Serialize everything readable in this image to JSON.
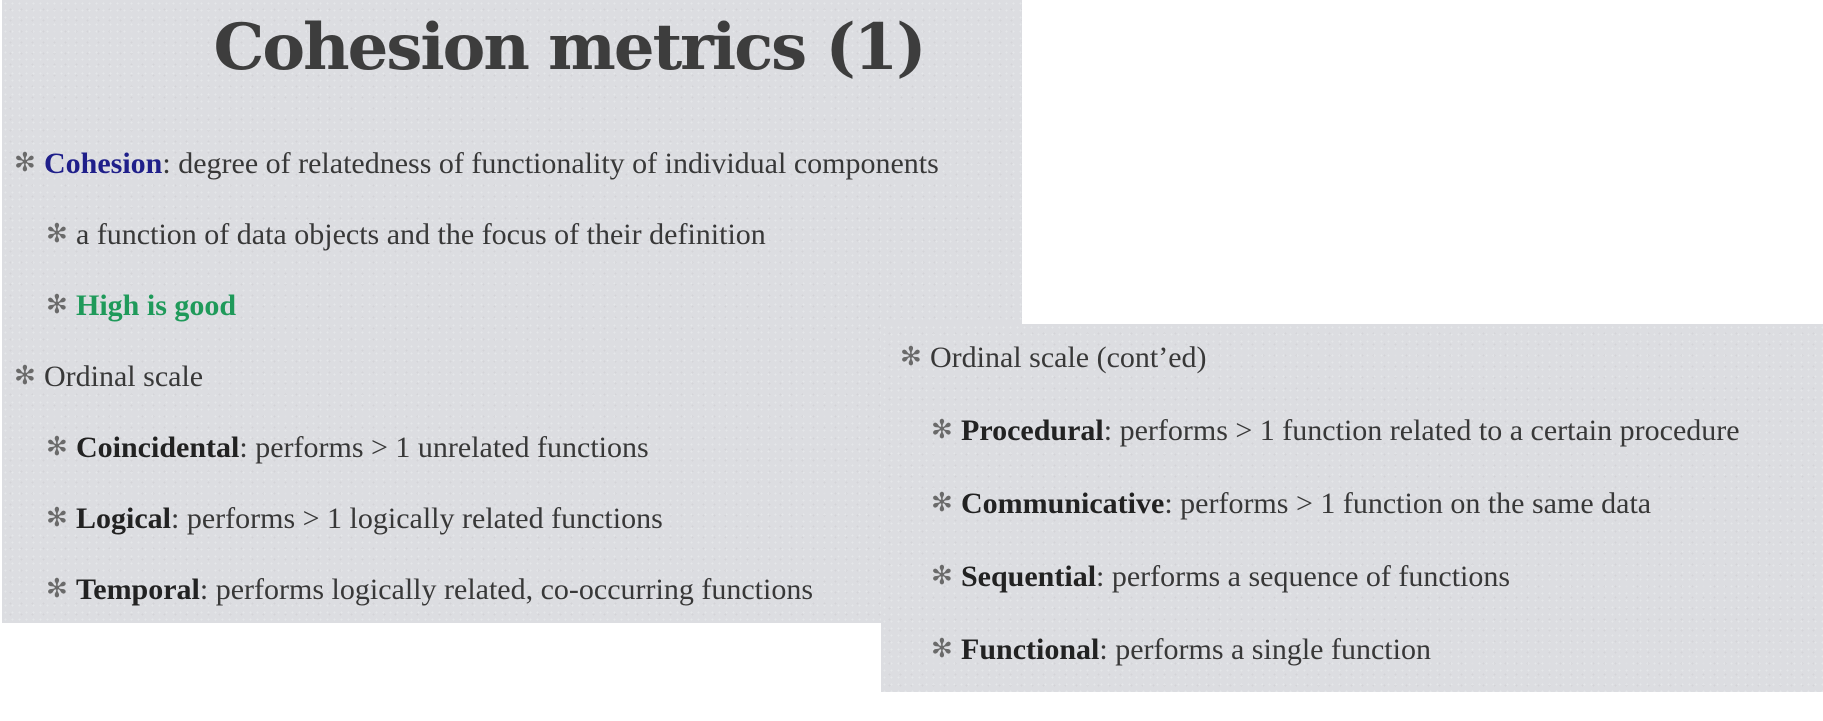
{
  "slide1": {
    "title": "Cohesion metrics (1)",
    "bullet_glyph": "✻",
    "items": [
      {
        "term": "Cohesion",
        "text": ": degree of relatedness of functionality of individual components"
      },
      {
        "text": "a function of data objects and the focus of their definition"
      },
      {
        "term": "High is good"
      },
      {
        "text": "Ordinal scale"
      },
      {
        "term": "Coincidental",
        "text": ": performs > 1 unrelated functions"
      },
      {
        "term": "Logical",
        "text": ": performs > 1 logically related functions"
      },
      {
        "term": "Temporal",
        "text": ": performs logically related, co-occurring functions"
      }
    ]
  },
  "slide2": {
    "items": [
      {
        "text": "Ordinal scale (cont’ed)"
      },
      {
        "term": "Procedural",
        "text": ": performs > 1 function related to a certain procedure"
      },
      {
        "term": "Communicative",
        "text": ": performs > 1 function on the same data"
      },
      {
        "term": "Sequential",
        "text": ": performs a sequence of functions"
      },
      {
        "term": "Functional",
        "text": ": performs a single function"
      }
    ]
  },
  "colors": {
    "slide_background": "#dcdde1",
    "body_text": "#383838",
    "cohesion_term": "#1f1f8a",
    "high_is_good": "#1f9a5a"
  }
}
